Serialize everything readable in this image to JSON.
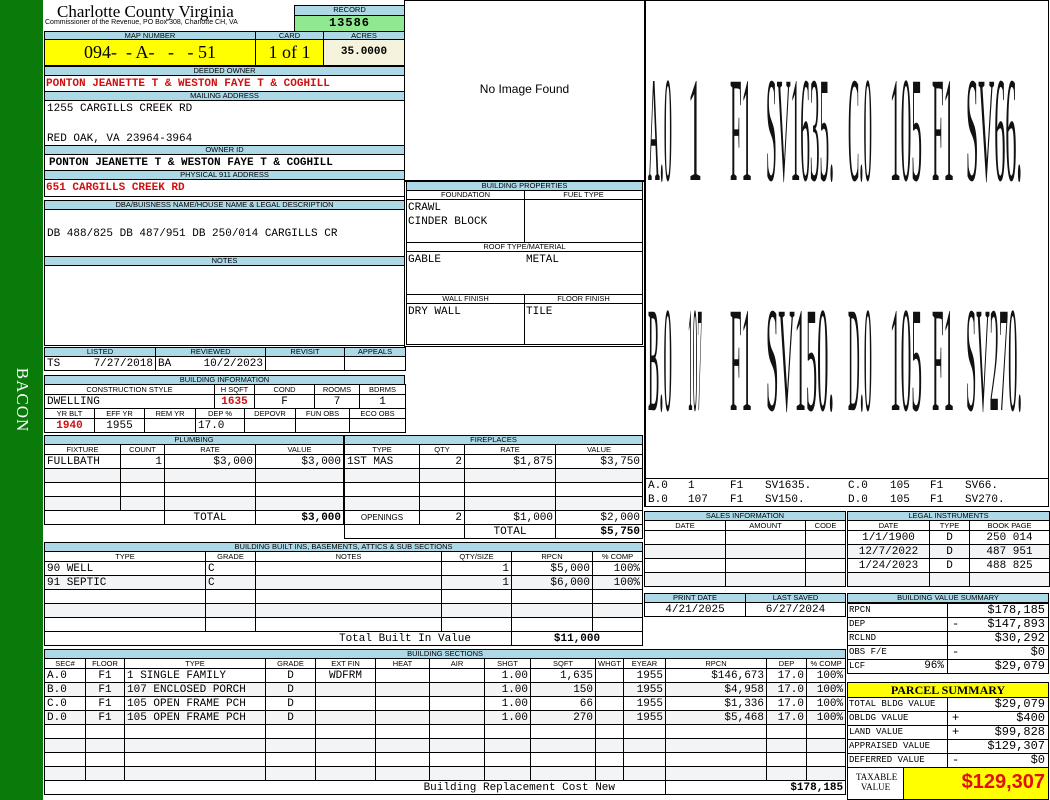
{
  "sidebar": {
    "label": "BACON",
    "color": "#0a7a0a"
  },
  "header": {
    "title": "Charlotte County Virginia",
    "subtitle": "Commissioner of the Revenue, PO Box 308, Charlotte CH, VA",
    "record_label": "RECORD",
    "record": "13586"
  },
  "parcel": {
    "map_label": "MAP NUMBER",
    "map": "094-  - A-   -   - 51",
    "card_label": "CARD",
    "card": "1 of 1",
    "acres_label": "ACRES",
    "acres": "35.0000"
  },
  "owner": {
    "deeded_label": "DEEDED OWNER",
    "deeded": "PONTON JEANETTE T & WESTON FAYE T & COGHILL",
    "mailing_label": "MAILING ADDRESS",
    "mailing_line1": "1255 CARGILLS CREEK RD",
    "mailing_line2": "RED OAK, VA 23964-3964",
    "owner_id_label": "OWNER ID",
    "owner_id": "PONTON JEANETTE T & WESTON FAYE T & COGHILL",
    "physical_label": "PHYSICAL 911 ADDRESS",
    "physical": "651 CARGILLS CREEK RD"
  },
  "dba": {
    "label": "DBA/BUISNESS NAME/HOUSE NAME & LEGAL DESCRIPTION",
    "text": "DB 488/825 DB 487/951 DB 250/014  CARGILLS CR"
  },
  "notes": {
    "label": "NOTES"
  },
  "photo": {
    "text": "No Image Found"
  },
  "building_properties": {
    "title": "BUILDING PROPERTIES",
    "foundation_label": "FOUNDATION",
    "foundation1": "CRAWL",
    "foundation2": "CINDER BLOCK",
    "fuel_label": "FUEL TYPE",
    "roof_label": "ROOF TYPE/MATERIAL",
    "roof_type": "GABLE",
    "roof_material": "METAL",
    "wall_label": "WALL FINISH",
    "wall": "DRY WALL",
    "floor_label": "FLOOR FINISH",
    "floor": "TILE"
  },
  "listed": {
    "columns": [
      "LISTED",
      "REVIEWED",
      "REVISIT",
      "APPEALS"
    ],
    "listed_by": "TS",
    "listed_date": "7/27/2018",
    "reviewed_by": "BA",
    "reviewed_date": "10/2/2023"
  },
  "building_info": {
    "title": "BUILDING INFORMATION",
    "columns1": [
      "CONSTRUCTION STYLE",
      "H SQFT",
      "COND",
      "ROOMS",
      "BDRMS"
    ],
    "values1": [
      "DWELLING",
      "1635",
      "F",
      "7",
      "1"
    ],
    "columns2": [
      "YR BLT",
      "EFF YR",
      "REM YR",
      "DEP %",
      "DEPOVR",
      "FUN OBS",
      "ECO OBS"
    ],
    "values2": [
      "1940",
      "1955",
      "",
      "17.0",
      "",
      "",
      ""
    ]
  },
  "plumbing": {
    "title": "PLUMBING",
    "columns": [
      "FIXTURE",
      "COUNT",
      "RATE",
      "VALUE"
    ],
    "rows": [
      [
        "FULLBATH",
        "1",
        "$3,000",
        "$3,000"
      ]
    ],
    "total_label": "TOTAL",
    "total": "$3,000"
  },
  "fireplaces": {
    "title": "FIREPLACES",
    "columns": [
      "TYPE",
      "QTY",
      "RATE",
      "VALUE"
    ],
    "rows": [
      [
        "1ST MAS",
        "2",
        "$1,875",
        "$3,750"
      ]
    ],
    "openings": [
      "OPENINGS",
      "2",
      "$1,000",
      "$2,000"
    ],
    "total_label": "TOTAL",
    "total": "$5,750"
  },
  "built_ins": {
    "title": "BUILDING BUILT INS, BASEMENTS, ATTICS & SUB SECTIONS",
    "columns": [
      "TYPE",
      "GRADE",
      "NOTES",
      "QTY/SIZE",
      "RPCN",
      "% COMP"
    ],
    "rows": [
      [
        "90 WELL",
        "C",
        "",
        "1",
        "$5,000",
        "100%"
      ],
      [
        "91 SEPTIC",
        "C",
        "",
        "1",
        "$6,000",
        "100%"
      ]
    ],
    "total_label": "Total Built In Value",
    "total": "$11,000"
  },
  "building_sections": {
    "title": "BUILDING SECTIONS",
    "columns": [
      "SEC#",
      "FLOOR",
      "TYPE",
      "GRADE",
      "EXT FIN",
      "HEAT",
      "AIR",
      "SHGT",
      "SQFT",
      "WHGT",
      "EYEAR",
      "RPCN",
      "DEP",
      "% COMP"
    ],
    "rows": [
      [
        "A.0",
        "F1",
        "1 SINGLE FAMILY",
        "D",
        "WDFRM",
        "",
        "",
        "1.00",
        "1,635",
        "",
        "1955",
        "$146,673",
        "17.0",
        "100%"
      ],
      [
        "B.0",
        "F1",
        "107 ENCLOSED PORCH",
        "D",
        "",
        "",
        "",
        "1.00",
        "150",
        "",
        "1955",
        "$4,958",
        "17.0",
        "100%"
      ],
      [
        "C.0",
        "F1",
        "105 OPEN FRAME PCH",
        "D",
        "",
        "",
        "",
        "1.00",
        "66",
        "",
        "1955",
        "$1,336",
        "17.0",
        "100%"
      ],
      [
        "D.0",
        "F1",
        "105 OPEN FRAME PCH",
        "D",
        "",
        "",
        "",
        "1.00",
        "270",
        "",
        "1955",
        "$5,468",
        "17.0",
        "100%"
      ]
    ],
    "total_label": "Building Replacement Cost New",
    "total": "$178,185"
  },
  "sketch": {
    "legend": [
      [
        "A.0",
        "1",
        "F1",
        "SV1635."
      ],
      [
        "C.0",
        "105",
        "F1",
        "SV66."
      ],
      [
        "B.0",
        "107",
        "F1",
        "SV150."
      ],
      [
        "D.0",
        "105",
        "F1",
        "SV270."
      ]
    ]
  },
  "sales": {
    "title": "SALES INFORMATION",
    "columns": [
      "DATE",
      "AMOUNT",
      "CODE"
    ],
    "rows": []
  },
  "legal": {
    "title": "LEGAL INSTRUMENTS",
    "columns": [
      "DATE",
      "TYPE",
      "BOOK PAGE"
    ],
    "rows": [
      [
        "1/1/1900",
        "D",
        "250 014"
      ],
      [
        "12/7/2022",
        "D",
        "487 951"
      ],
      [
        "1/24/2023",
        "D",
        "488 825"
      ]
    ]
  },
  "dates": {
    "print_label": "PRINT DATE",
    "print": "4/21/2025",
    "saved_label": "LAST SAVED",
    "saved": "6/27/2024"
  },
  "value_summary": {
    "title": "BUILDING VALUE SUMMARY",
    "rows": [
      [
        "RPCN",
        "",
        "$178,185"
      ],
      [
        "DEP",
        "-",
        "$147,893"
      ],
      [
        "RCLND",
        "",
        "$30,292"
      ],
      [
        "OBS F/E",
        "-",
        "$0"
      ],
      [
        "LCF",
        "96%",
        "$29,079"
      ]
    ]
  },
  "parcel_summary": {
    "title": "PARCEL SUMMARY",
    "rows": [
      [
        "TOTAL BLDG VALUE",
        "",
        "$29,079"
      ],
      [
        "OBLDG VALUE",
        "+",
        "$400"
      ],
      [
        "LAND VALUE",
        "+",
        "$99,828"
      ],
      [
        "APPRAISED VALUE",
        "",
        "$129,307"
      ],
      [
        "DEFERRED VALUE",
        "-",
        "$0"
      ]
    ],
    "taxable_label": "TAXABLE VALUE",
    "taxable": "$129,307",
    "accent": "#ffff00"
  }
}
